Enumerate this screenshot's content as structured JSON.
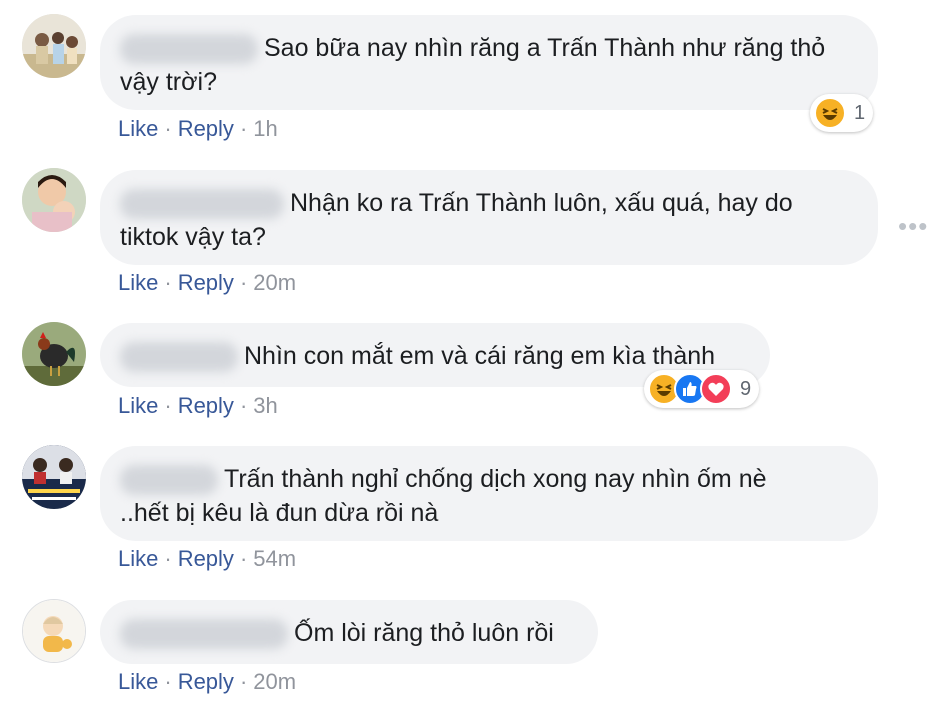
{
  "comments": [
    {
      "text_line1": "Sao bữa nay nhìn răng a Trấn Thành như răng thỏ",
      "text_line2": "vậy trời?",
      "like": "Like",
      "reply": "Reply",
      "time": "1h",
      "reaction_count": "1",
      "reaction_icons": [
        "haha-icon"
      ]
    },
    {
      "text_line1": "Nhận ko ra Trấn Thành luôn, xấu quá, hay do",
      "text_line2": "tiktok vậy ta?",
      "like": "Like",
      "reply": "Reply",
      "time": "20m"
    },
    {
      "text_line1": "Nhìn con mắt em và cái răng em kìa thành",
      "like": "Like",
      "reply": "Reply",
      "time": "3h",
      "reaction_count": "9",
      "reaction_icons": [
        "haha-icon",
        "like-icon",
        "love-icon"
      ]
    },
    {
      "text_line1": "Trấn thành nghỉ chống dịch xong nay nhìn ốm nè",
      "text_line2": "..hết bị kêu là đun dừa rồi nà",
      "like": "Like",
      "reply": "Reply",
      "time": "54m"
    },
    {
      "text_line1": "Ốm lòi răng thỏ luôn rồi",
      "like": "Like",
      "reply": "Reply",
      "time": "20m"
    }
  ],
  "more_options": "•••",
  "colors": {
    "link": "#385898",
    "meta": "#90949c",
    "bubble": "#f2f3f5",
    "haha": "#f7b125",
    "like": "#1877f2",
    "love": "#f33e58"
  }
}
